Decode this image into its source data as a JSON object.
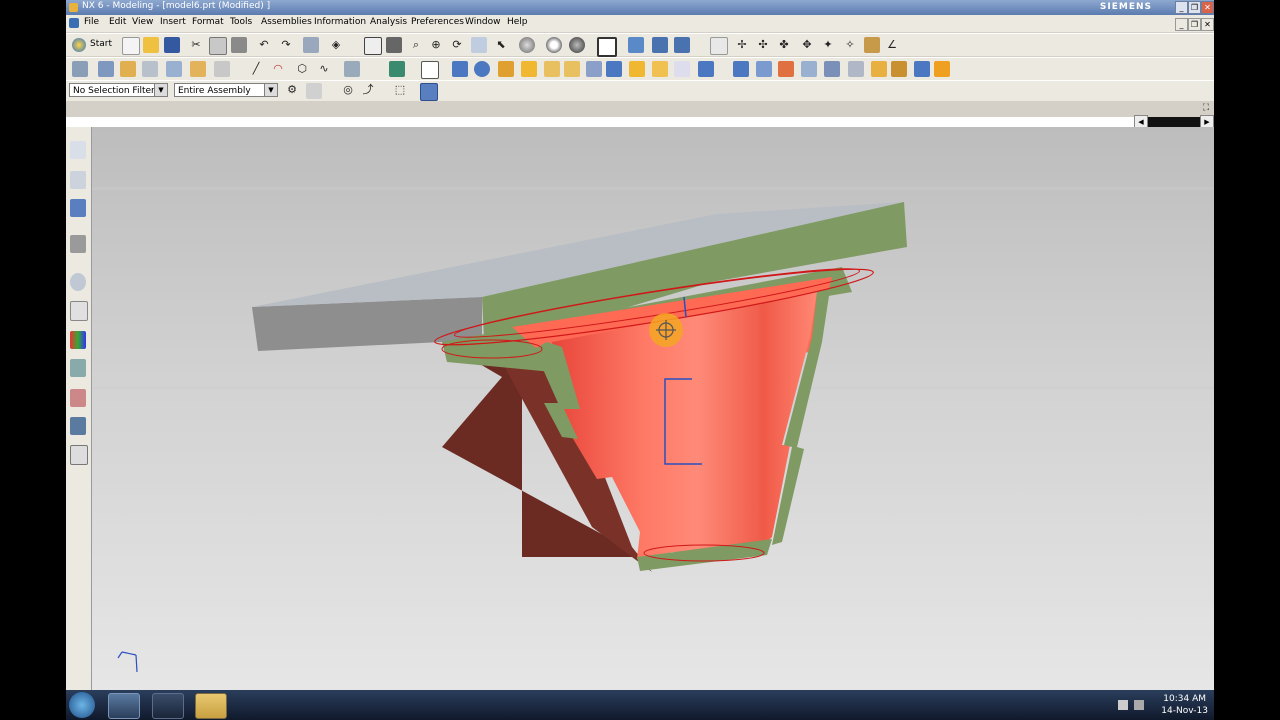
{
  "window": {
    "title": "NX 6 - Modeling - [model6.prt (Modified) ]",
    "brand": "SIEMENS",
    "controls": [
      "_",
      "❐",
      "✕"
    ]
  },
  "menu": [
    "File",
    "Edit",
    "View",
    "Insert",
    "Format",
    "Tools",
    "Assemblies",
    "Information",
    "Analysis",
    "Preferences",
    "Window",
    "Help"
  ],
  "toolbar": {
    "start_label": "Start",
    "selection_filter": "No Selection Filter",
    "scope": "Entire Assembly"
  },
  "model_colors": {
    "cone": "#ff6a55",
    "flange_top": "#7f9a62",
    "plate_top": "#b9bec4",
    "plate_side": "#8a8a8a",
    "wall_dark": "#6b2a22",
    "outline": "#d01818"
  },
  "taskbar": {
    "time": "10:34 AM",
    "date": "14-Nov-13"
  }
}
